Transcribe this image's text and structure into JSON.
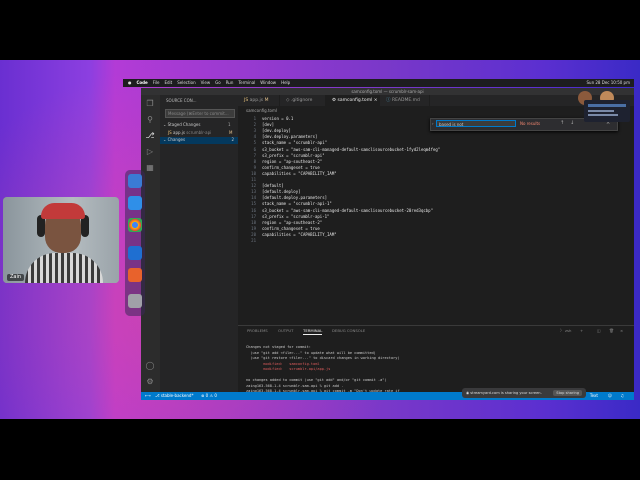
{
  "desktop": {
    "webcam_name": "Zain"
  },
  "menubar": {
    "app_name": "Code",
    "items": [
      "File",
      "Edit",
      "Selection",
      "View",
      "Go",
      "Run",
      "Terminal",
      "Window",
      "Help"
    ],
    "clock": "Sun 28 Dec  10:50 pm"
  },
  "window": {
    "title": "samconfig.toml — scrumblr-sam-api"
  },
  "sidebar": {
    "header": "SOURCE CON...",
    "commit_placeholder": "Message (⌘Enter to commit...",
    "staged_label": "Staged Changes",
    "staged_count": "1",
    "staged_file": "app.js",
    "staged_file_path": "scrumblr-api",
    "staged_file_status": "M",
    "changes_label": "Changes",
    "changes_count": "2"
  },
  "tabs": [
    {
      "label": "app.js",
      "status": "M"
    },
    {
      "label": ".gitignore",
      "status": ""
    },
    {
      "label": "samconfig.toml",
      "status": ""
    },
    {
      "label": "README.md",
      "status": ""
    }
  ],
  "breadcrumb": "samconfig.toml",
  "find": {
    "query": "based is not",
    "result": "No results"
  },
  "editor": {
    "lines": [
      {
        "n": "1",
        "text": "version = 0.1"
      },
      {
        "n": "2",
        "text": "[dev]"
      },
      {
        "n": "3",
        "text": "[dev.deploy]"
      },
      {
        "n": "4",
        "text": "[dev.deploy.parameters]"
      },
      {
        "n": "5",
        "text": "stack_name = \"scrumblr-api\""
      },
      {
        "n": "6",
        "text": "s3_bucket = \"aws-sam-cli-managed-default-samclisourcebucket-1fyd2leqm4feg\""
      },
      {
        "n": "7",
        "text": "s3_prefix = \"scrumblr-api\""
      },
      {
        "n": "8",
        "text": "region = \"ap-southeast-2\""
      },
      {
        "n": "9",
        "text": "confirm_changeset = true"
      },
      {
        "n": "10",
        "text": "capabilities = \"CAPABILITY_IAM\""
      },
      {
        "n": "11",
        "text": ""
      },
      {
        "n": "12",
        "text": "[default]"
      },
      {
        "n": "13",
        "text": "[default.deploy]"
      },
      {
        "n": "14",
        "text": "[default.deploy.parameters]"
      },
      {
        "n": "15",
        "text": "stack_name = \"scrumblr-api-1\""
      },
      {
        "n": "16",
        "text": "s3_bucket = \"aws-sam-cli-managed-default-samclisourcebucket-20red3qcbp\""
      },
      {
        "n": "17",
        "text": "s3_prefix = \"scrumblr-api-1\""
      },
      {
        "n": "18",
        "text": "region = \"ap-southeast-2\""
      },
      {
        "n": "19",
        "text": "confirm_changeset = true"
      },
      {
        "n": "20",
        "text": "capabilities = \"CAPABILITY_IAM\""
      },
      {
        "n": "21",
        "text": ""
      }
    ]
  },
  "panel": {
    "tabs": [
      "PROBLEMS",
      "OUTPUT",
      "TERMINAL",
      "DEBUG CONSOLE"
    ],
    "active_tab": "TERMINAL",
    "shell": "zsh",
    "terminal_lines": [
      "Changes not staged for commit:",
      "  (use \"git add <file>...\" to update what will be committed)",
      "  (use \"git restore <file>...\" to discard changes in working directory)",
      "        modified:   samconfig.toml",
      "        modified:   scrumblr-api/app.js",
      "",
      "no changes added to commit (use \"git add\" and/or \"git commit -a\")",
      "zaing163-568-1-4 scrumblr-sam-api % git add .",
      "zaing163-568-1-4 scrumblr-sam-api % git commit -m \"Don't update rate if "
    ]
  },
  "statusbar": {
    "branch": "stable-backend*",
    "errors": "0",
    "warnings": "0",
    "right": "Text"
  },
  "sharing": {
    "message": "streamyard.com is sharing your screen.",
    "button": "Stop sharing"
  }
}
